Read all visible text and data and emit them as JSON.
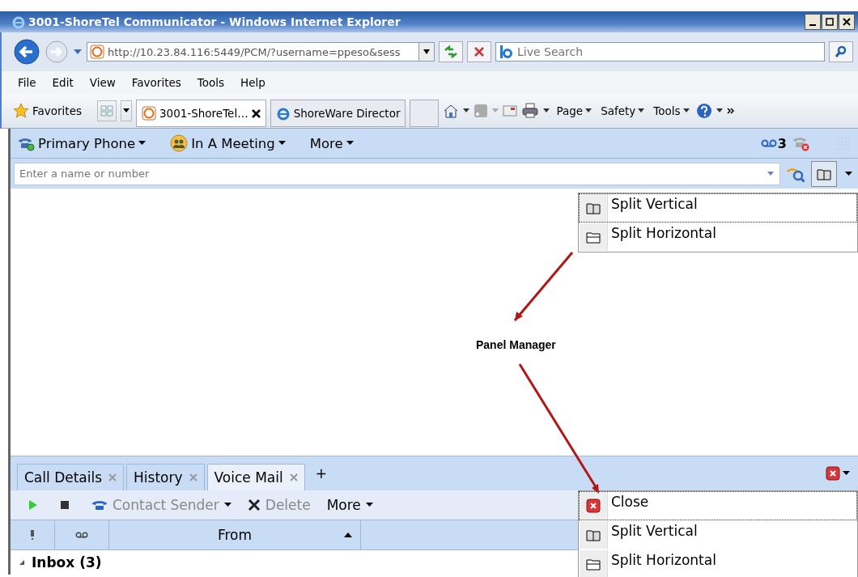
{
  "window": {
    "title": "3001-ShoreTel Communicator - Windows Internet Explorer"
  },
  "address_bar": {
    "url": "http://10.23.84.116:5449/PCM/?username=ppeso&sess",
    "search_placeholder": "Live Search"
  },
  "menu": [
    "File",
    "Edit",
    "View",
    "Favorites",
    "Tools",
    "Help"
  ],
  "favorites_bar": {
    "favorites_label": "Favorites",
    "tabs": [
      {
        "label": "3001-ShoreTel…",
        "selected": true
      },
      {
        "label": "ShoreWare Director",
        "selected": false
      }
    ],
    "commands": [
      "Page",
      "Safety",
      "Tools"
    ]
  },
  "app_toolbar": {
    "items": [
      {
        "label": "Primary Phone",
        "kind": "phone"
      },
      {
        "label": "In A Meeting",
        "kind": "status"
      },
      {
        "label": "More",
        "kind": "plain"
      }
    ],
    "voicemail_count": "3"
  },
  "search": {
    "placeholder": "Enter a name or number"
  },
  "panel_menu_top": [
    {
      "label": "Split Vertical",
      "kind": "vertical",
      "selected": true
    },
    {
      "label": "Split Horizontal",
      "kind": "horizontal",
      "selected": false
    }
  ],
  "annotation": "Panel Manager",
  "bottom_tabs": [
    {
      "label": "Call Details",
      "selected": false
    },
    {
      "label": "History",
      "selected": false
    },
    {
      "label": "Voice Mail",
      "selected": true
    }
  ],
  "add_tab": "+",
  "vm_toolbar": [
    {
      "label": "Contact Sender",
      "kind": "contact",
      "disabled": true
    },
    {
      "label": "Delete",
      "kind": "delete",
      "disabled": true
    },
    {
      "label": "More",
      "kind": "plain",
      "disabled": false
    }
  ],
  "table": {
    "columns": [
      {
        "kind": "priority"
      },
      {
        "kind": "voicemail"
      },
      {
        "kind": "text",
        "label": "From"
      }
    ],
    "groups": [
      {
        "label": "Inbox (3)",
        "expanded": true
      }
    ]
  },
  "panel_menu_bottom": [
    {
      "label": "Close",
      "kind": "close",
      "selected": true
    },
    {
      "label": "Split Vertical",
      "kind": "vertical",
      "selected": false
    },
    {
      "label": "Split Horizontal",
      "kind": "horizontal",
      "selected": false
    }
  ]
}
